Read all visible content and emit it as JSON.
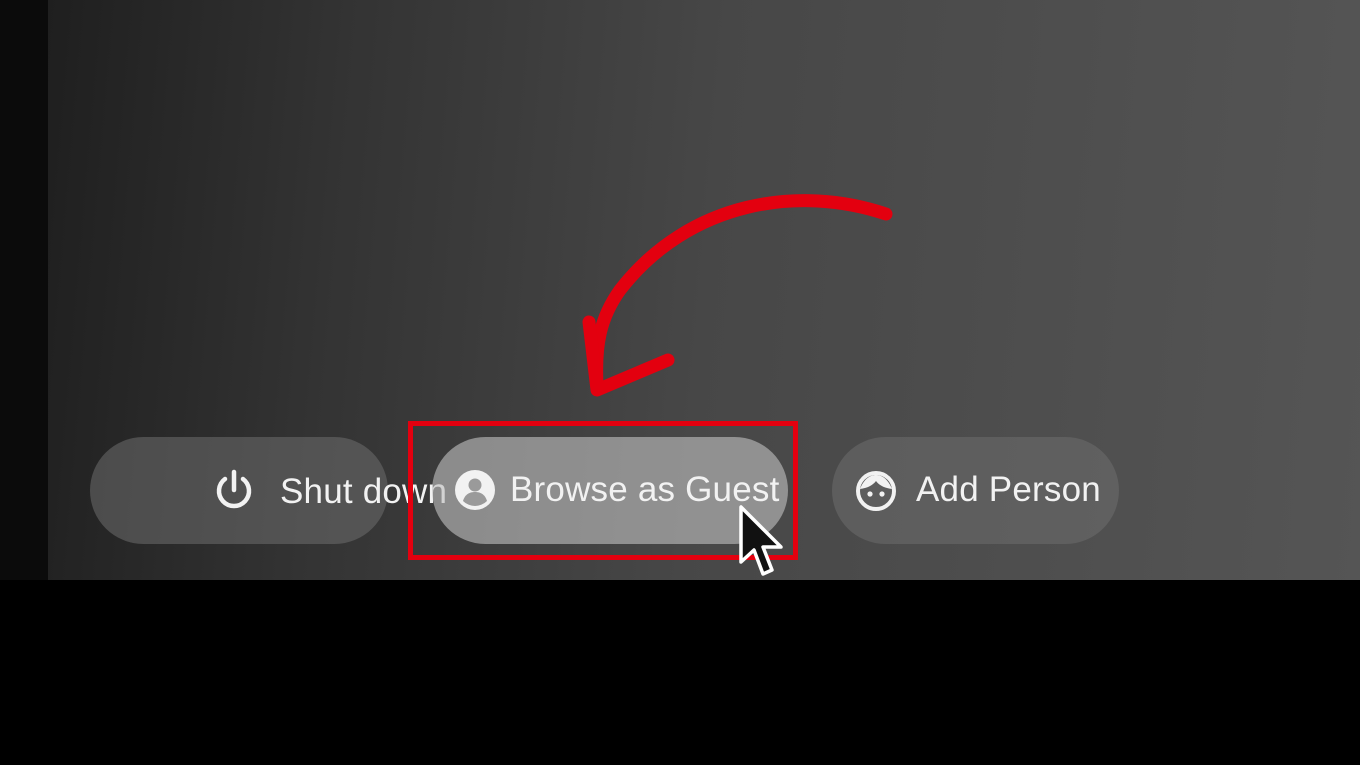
{
  "buttons": {
    "shutdown": {
      "label": "Shut down",
      "icon": "power-icon"
    },
    "guest": {
      "label": "Browse as Guest",
      "icon": "account-circle-icon"
    },
    "add_person": {
      "label": "Add Person",
      "icon": "face-icon"
    }
  },
  "annotation": {
    "color": "#e3000f",
    "target": "guest"
  },
  "colors": {
    "background": "#000000",
    "screen": "#474747",
    "pill": "#6e6e6e",
    "pill_highlighted": "#bebebe",
    "text": "#f2f2f2"
  }
}
